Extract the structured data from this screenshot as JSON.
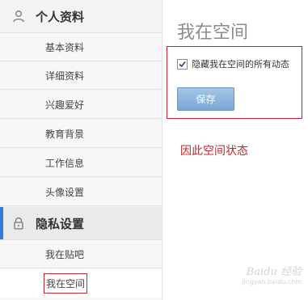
{
  "sidebar": {
    "profile_section": {
      "label": "个人资料",
      "icon": "person-icon"
    },
    "profile_items": [
      {
        "label": "基本资料"
      },
      {
        "label": "详细资料"
      },
      {
        "label": "兴趣爱好"
      },
      {
        "label": "教育背景"
      },
      {
        "label": "工作信息"
      },
      {
        "label": "头像设置"
      }
    ],
    "privacy_section": {
      "label": "隐私设置",
      "icon": "lock-icon"
    },
    "privacy_items": [
      {
        "label": "我在贴吧"
      },
      {
        "label": "我在空间"
      }
    ]
  },
  "main": {
    "title": "我在空间",
    "option": {
      "label": "隐藏我在空间的所有动态",
      "checked": true
    },
    "save_label": "保存"
  },
  "annotation": {
    "text": "因此空间状态"
  },
  "watermark": {
    "logo": "Baidu 经验",
    "url": "jingyan.baidu.com"
  },
  "colors": {
    "accent": "#2f7bd6",
    "highlight": "#c1272d",
    "button": "#7aa8d6"
  }
}
